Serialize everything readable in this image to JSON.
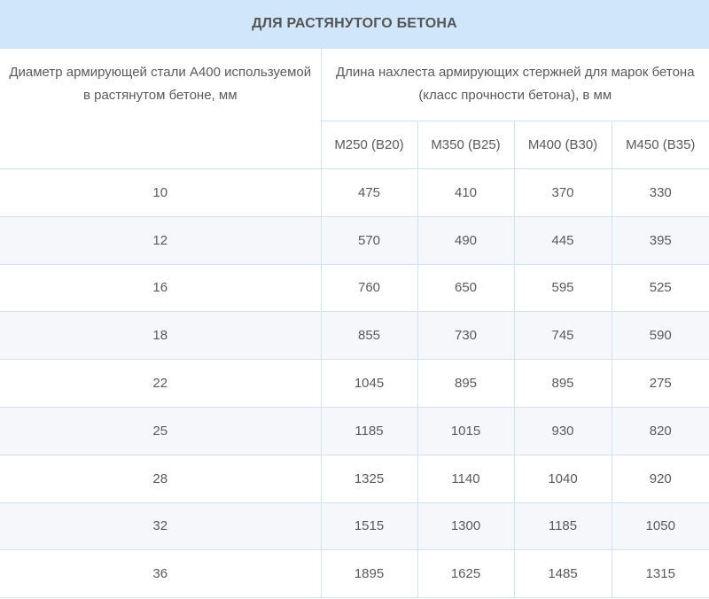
{
  "title": "ДЛЯ РАСТЯНУТОГО БЕТОНА",
  "table": {
    "col1_header": "Диаметр армирующей стали А400 используемой в растянутом бетоне, мм",
    "group_header": "Длина нахлеста армирующих стержней для марок бетона (класс прочности бетона), в мм",
    "grades": [
      "М250 (В20)",
      "М350 (В25)",
      "М400 (В30)",
      "М450 (В35)"
    ],
    "rows": [
      {
        "d": "10",
        "v": [
          "475",
          "410",
          "370",
          "330"
        ]
      },
      {
        "d": "12",
        "v": [
          "570",
          "490",
          "445",
          "395"
        ]
      },
      {
        "d": "16",
        "v": [
          "760",
          "650",
          "595",
          "525"
        ]
      },
      {
        "d": "18",
        "v": [
          "855",
          "730",
          "745",
          "590"
        ]
      },
      {
        "d": "22",
        "v": [
          "1045",
          "895",
          "895",
          "275"
        ]
      },
      {
        "d": "25",
        "v": [
          "1185",
          "1015",
          "930",
          "820"
        ]
      },
      {
        "d": "28",
        "v": [
          "1325",
          "1140",
          "1040",
          "920"
        ]
      },
      {
        "d": "32",
        "v": [
          "1515",
          "1300",
          "1185",
          "1050"
        ]
      },
      {
        "d": "36",
        "v": [
          "1895",
          "1625",
          "1485",
          "1315"
        ]
      }
    ]
  },
  "colors": {
    "title_bg": "#cfe6fb",
    "border": "#cfe3f5",
    "alt_row_bg": "#f6f7fb",
    "text": "#5a5a5a"
  }
}
